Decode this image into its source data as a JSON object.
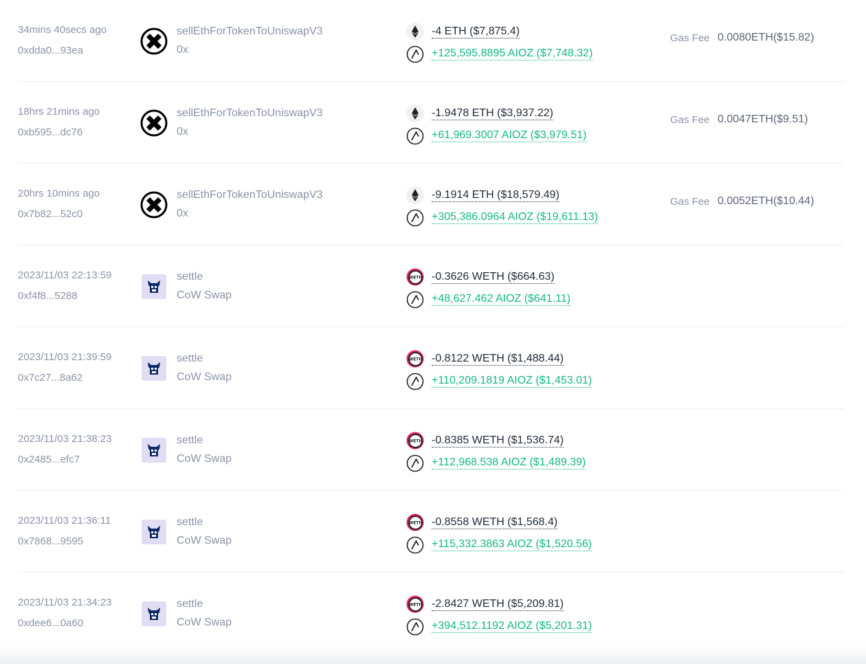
{
  "colors": {
    "muted_text": "#8a93a6",
    "outgoing_amount": "#1f2937",
    "incoming_amount": "#12b886",
    "divider": "#eceef2"
  },
  "rows": [
    {
      "time": "34mins 40secs ago",
      "hash": "0xdda0...93ea",
      "protocol_icon": "0x-protocol-icon",
      "method": "sellEthForTokenToUniswapV3",
      "protocol": "0x",
      "token_out_icon": "eth-icon",
      "token_out": "-4 ETH ($7,875.4)",
      "token_in_icon": "aioz-icon",
      "token_in": "+125,595.8895 AIOZ ($7,748.32)",
      "gas_label": "Gas Fee",
      "gas_fee": "0.0080ETH($15.82)"
    },
    {
      "time": "18hrs 21mins ago",
      "hash": "0xb595...dc76",
      "protocol_icon": "0x-protocol-icon",
      "method": "sellEthForTokenToUniswapV3",
      "protocol": "0x",
      "token_out_icon": "eth-icon",
      "token_out": "-1.9478 ETH ($3,937.22)",
      "token_in_icon": "aioz-icon",
      "token_in": "+61,969.3007 AIOZ ($3,979.51)",
      "gas_label": "Gas Fee",
      "gas_fee": "0.0047ETH($9.51)"
    },
    {
      "time": "20hrs 10mins ago",
      "hash": "0x7b82...52c0",
      "protocol_icon": "0x-protocol-icon",
      "method": "sellEthForTokenToUniswapV3",
      "protocol": "0x",
      "token_out_icon": "eth-icon",
      "token_out": "-9.1914 ETH ($18,579.49)",
      "token_in_icon": "aioz-icon",
      "token_in": "+305,386.0964 AIOZ ($19,611.13)",
      "gas_label": "Gas Fee",
      "gas_fee": "0.0052ETH($10.44)"
    },
    {
      "time": "2023/11/03 22:13:59",
      "hash": "0xf4f8...5288",
      "protocol_icon": "cow-swap-icon",
      "method": "settle",
      "protocol": "CoW Swap",
      "token_out_icon": "weth-icon",
      "token_out": "-0.3626 WETH ($664.63)",
      "token_in_icon": "aioz-icon",
      "token_in": "+48,627.462 AIOZ ($641.11)",
      "gas_label": "",
      "gas_fee": ""
    },
    {
      "time": "2023/11/03 21:39:59",
      "hash": "0x7c27...8a62",
      "protocol_icon": "cow-swap-icon",
      "method": "settle",
      "protocol": "CoW Swap",
      "token_out_icon": "weth-icon",
      "token_out": "-0.8122 WETH ($1,488.44)",
      "token_in_icon": "aioz-icon",
      "token_in": "+110,209.1819 AIOZ ($1,453.01)",
      "gas_label": "",
      "gas_fee": ""
    },
    {
      "time": "2023/11/03 21:38:23",
      "hash": "0x2485...efc7",
      "protocol_icon": "cow-swap-icon",
      "method": "settle",
      "protocol": "CoW Swap",
      "token_out_icon": "weth-icon",
      "token_out": "-0.8385 WETH ($1,536.74)",
      "token_in_icon": "aioz-icon",
      "token_in": "+112,968.538 AIOZ ($1,489.39)",
      "gas_label": "",
      "gas_fee": ""
    },
    {
      "time": "2023/11/03 21:36:11",
      "hash": "0x7868...9595",
      "protocol_icon": "cow-swap-icon",
      "method": "settle",
      "protocol": "CoW Swap",
      "token_out_icon": "weth-icon",
      "token_out": "-0.8558 WETH ($1,568.4)",
      "token_in_icon": "aioz-icon",
      "token_in": "+115,332.3863 AIOZ ($1,520.56)",
      "gas_label": "",
      "gas_fee": ""
    },
    {
      "time": "2023/11/03 21:34:23",
      "hash": "0xdee6...0a60",
      "protocol_icon": "cow-swap-icon",
      "method": "settle",
      "protocol": "CoW Swap",
      "token_out_icon": "weth-icon",
      "token_out": "-2.8427 WETH ($5,209.81)",
      "token_in_icon": "aioz-icon",
      "token_in": "+394,512.1192 AIOZ ($5,201.31)",
      "gas_label": "",
      "gas_fee": ""
    }
  ]
}
